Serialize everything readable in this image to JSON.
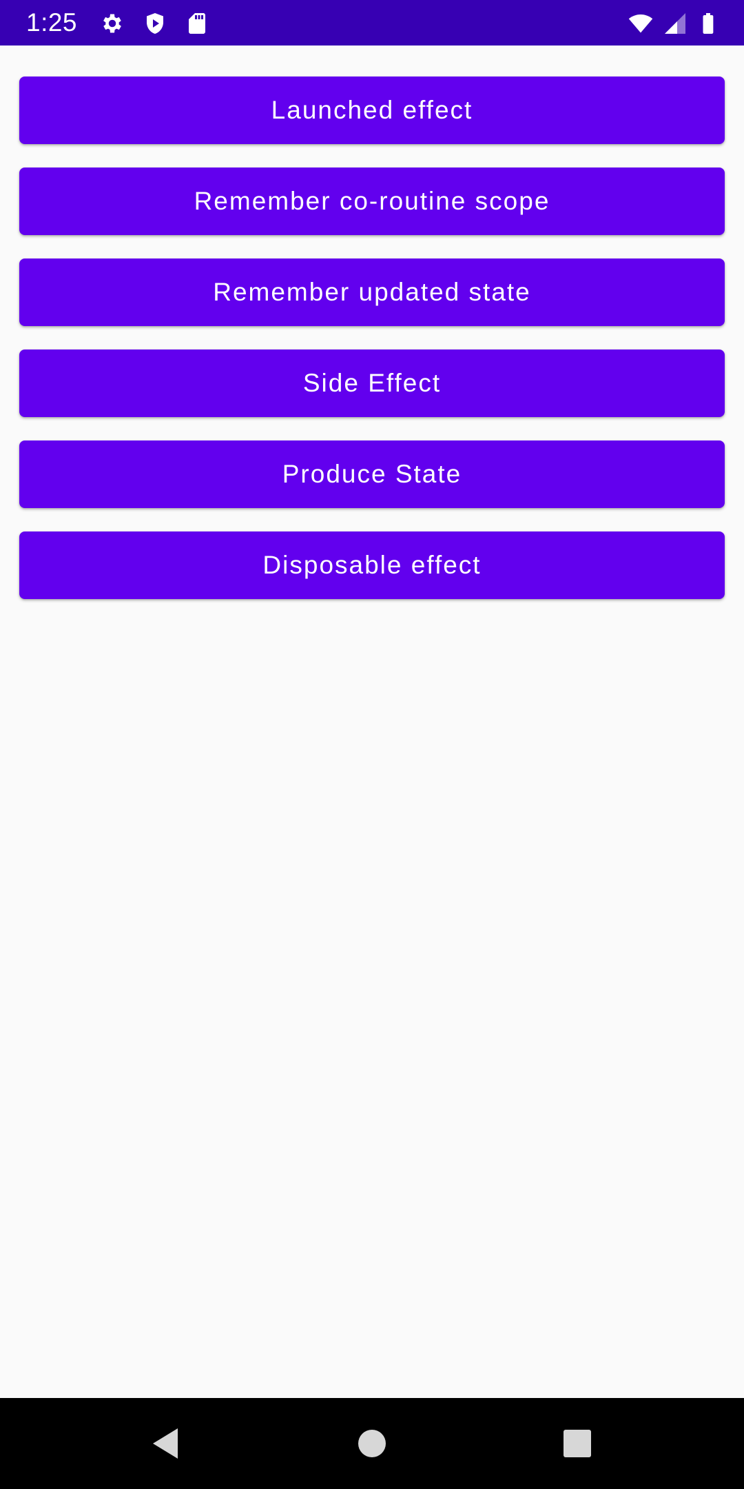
{
  "status_bar": {
    "time": "1:25",
    "background_color": "#3700B3",
    "left_icons": [
      "gear-icon",
      "shield-icon",
      "sd-card-icon"
    ],
    "right_icons": [
      "wifi-icon",
      "cell-signal-icon",
      "battery-icon"
    ]
  },
  "buttons": [
    {
      "label": "Launched effect"
    },
    {
      "label": "Remember co-routine scope"
    },
    {
      "label": "Remember updated state"
    },
    {
      "label": "Side Effect"
    },
    {
      "label": "Produce State"
    },
    {
      "label": "Disposable effect"
    }
  ],
  "colors": {
    "button": "#6200EE",
    "background": "#FAFAFA",
    "nav_bar": "#000000"
  },
  "nav_bar": {
    "icons": [
      "back-icon",
      "home-icon",
      "recents-icon"
    ]
  }
}
